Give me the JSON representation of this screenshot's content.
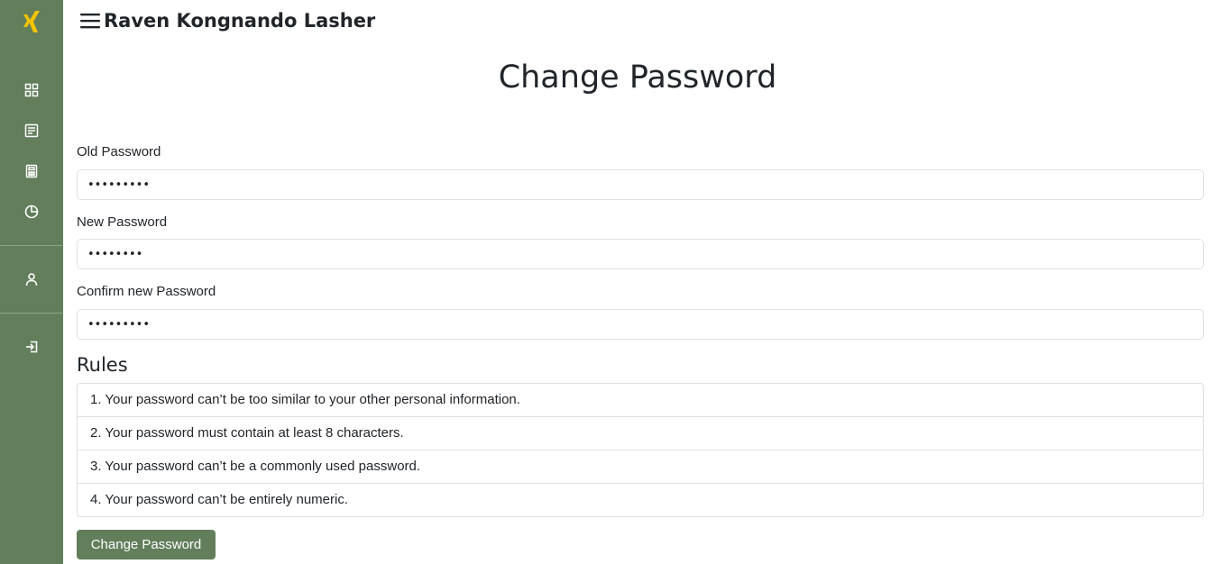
{
  "header": {
    "user_name": "Raven Kongnando Lasher"
  },
  "sidebar": {
    "logo": "xing-logo",
    "items": [
      {
        "icon": "grid-icon"
      },
      {
        "icon": "document-list-icon"
      },
      {
        "icon": "calculator-icon"
      },
      {
        "icon": "pie-chart-icon"
      },
      {
        "icon": "user-icon"
      },
      {
        "icon": "sign-in-icon"
      }
    ]
  },
  "form": {
    "title": "Change Password",
    "old_password": {
      "label": "Old Password",
      "value": "•••••••••"
    },
    "new_password": {
      "label": "New Password",
      "value": "••••••••"
    },
    "confirm_password": {
      "label": "Confirm new Password",
      "value": "•••••••••"
    },
    "submit_label": "Change Password"
  },
  "rules": {
    "title": "Rules",
    "items": [
      "1. Your password can’t be too similar to your other personal information.",
      "2. Your password must contain at least 8 characters.",
      "3. Your password can’t be a commonly used password.",
      "4. Your password can’t be entirely numeric."
    ]
  },
  "colors": {
    "sidebar_bg": "#627e5b",
    "button_bg": "#627e5b",
    "logo": "#f2c300"
  }
}
